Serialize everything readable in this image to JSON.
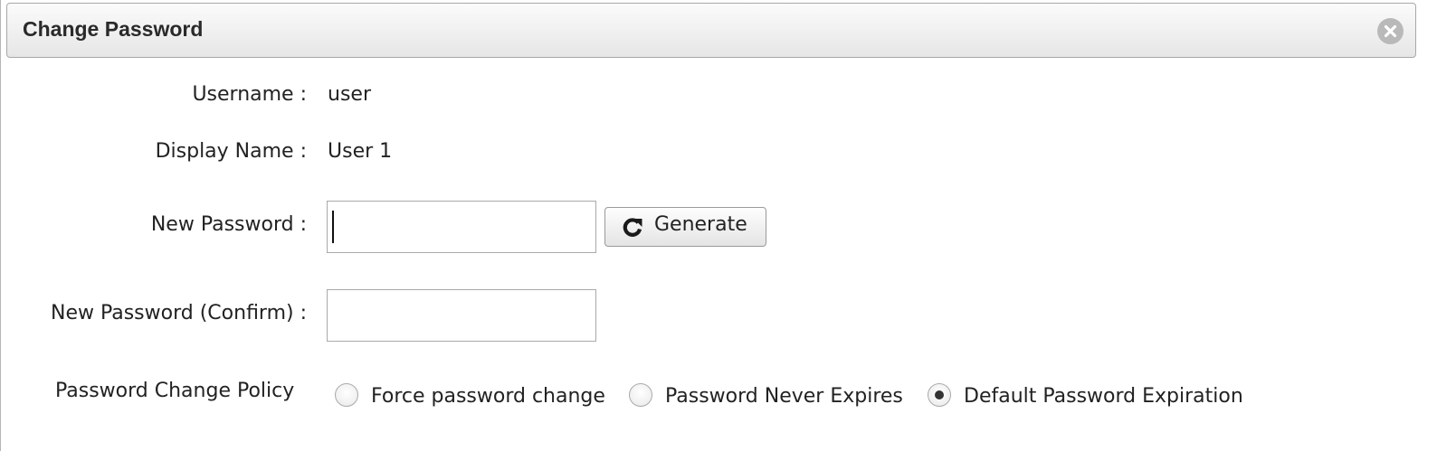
{
  "dialog": {
    "title": "Change Password",
    "close_icon": "close-circle-icon"
  },
  "form": {
    "username": {
      "label": "Username :",
      "value": "user"
    },
    "display_name": {
      "label": "Display Name :",
      "value": "User 1"
    },
    "new_password": {
      "label": "New Password :",
      "value": "",
      "placeholder": ""
    },
    "generate_button": {
      "label": "Generate",
      "icon": "refresh-icon"
    },
    "confirm_password": {
      "label": "New Password (Confirm) :",
      "value": "",
      "placeholder": ""
    },
    "policy": {
      "label": "Password Change Policy",
      "options": [
        {
          "label": "Force password change",
          "selected": false
        },
        {
          "label": "Password Never Expires",
          "selected": false
        },
        {
          "label": "Default Password Expiration",
          "selected": true
        }
      ]
    }
  }
}
